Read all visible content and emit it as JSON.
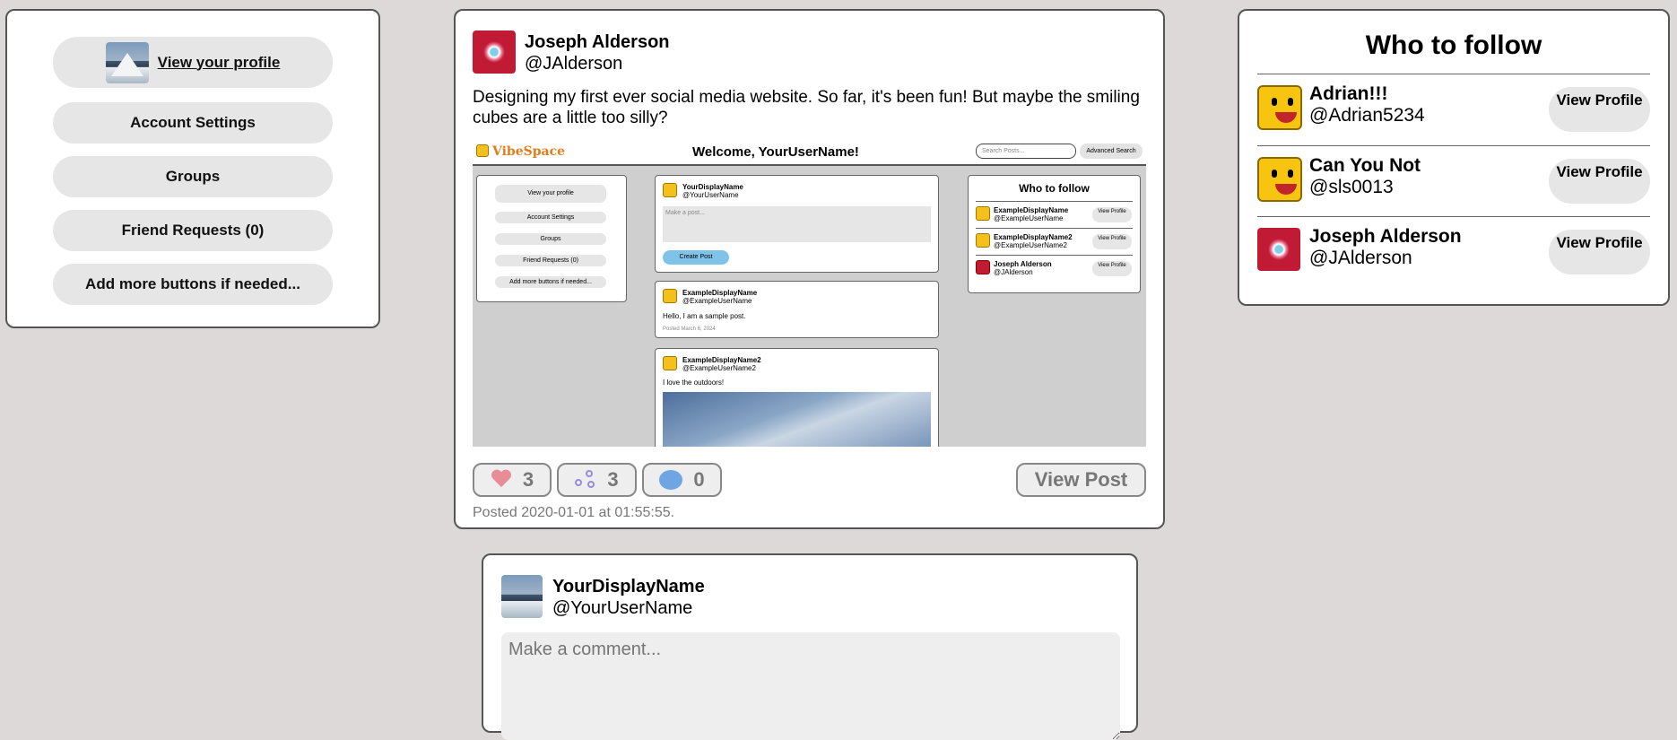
{
  "sidebar": {
    "profile_label": "View your profile",
    "buttons": [
      "Account Settings",
      "Groups",
      "Friend Requests (0)",
      "Add more buttons if needed..."
    ]
  },
  "post": {
    "author_name": "Joseph Alderson",
    "author_handle": "@JAlderson",
    "text": "Designing my first ever social media website. So far, it's been fun! But maybe the smiling cubes are a little too silly?",
    "likes": "3",
    "shares": "3",
    "comments": "0",
    "view_post_label": "View Post",
    "posted": "Posted 2020-01-01 at 01:55:55."
  },
  "screenshot": {
    "logo": "VibeSpace",
    "welcome": "Welcome, YourUserName!",
    "search_placeholder": "Search Posts...",
    "advanced_search": "Advanced Search",
    "sidebar_buttons": [
      "View your profile",
      "Account Settings",
      "Groups",
      "Friend Requests (0)",
      "Add more buttons if needed..."
    ],
    "composer": {
      "name": "YourDisplayName",
      "handle": "@YourUserName",
      "placeholder": "Make a post...",
      "button": "Create Post"
    },
    "post1": {
      "name": "ExampleDisplayName",
      "handle": "@ExampleUserName",
      "text": "Hello, I am a sample post.",
      "date": "Posted March 6, 2024"
    },
    "post2": {
      "name": "ExampleDisplayName2",
      "handle": "@ExampleUserName2",
      "text": "I love the outdoors!"
    },
    "follow_title": "Who to follow",
    "follow": [
      {
        "name": "ExampleDisplayName",
        "handle": "@ExampleUserName"
      },
      {
        "name": "ExampleDisplayName2",
        "handle": "@ExampleUserName2"
      },
      {
        "name": "Joseph Alderson",
        "handle": "@JAlderson"
      }
    ],
    "view_profile": "View Profile"
  },
  "follow": {
    "title": "Who to follow",
    "users": [
      {
        "name": "Adrian!!!",
        "handle": "@Adrian5234",
        "button": "View Profile"
      },
      {
        "name": "Can You Not",
        "handle": "@sls0013",
        "button": "View Profile"
      },
      {
        "name": "Joseph Alderson",
        "handle": "@JAlderson",
        "button": "View Profile"
      }
    ]
  },
  "comment": {
    "name": "YourDisplayName",
    "handle": "@YourUserName",
    "placeholder": "Make a comment..."
  },
  "colors": {
    "background": "#dcd9d8",
    "button": "#e6e6e6",
    "accent_orange": "#e57c1c",
    "heart": "#e88c96"
  }
}
